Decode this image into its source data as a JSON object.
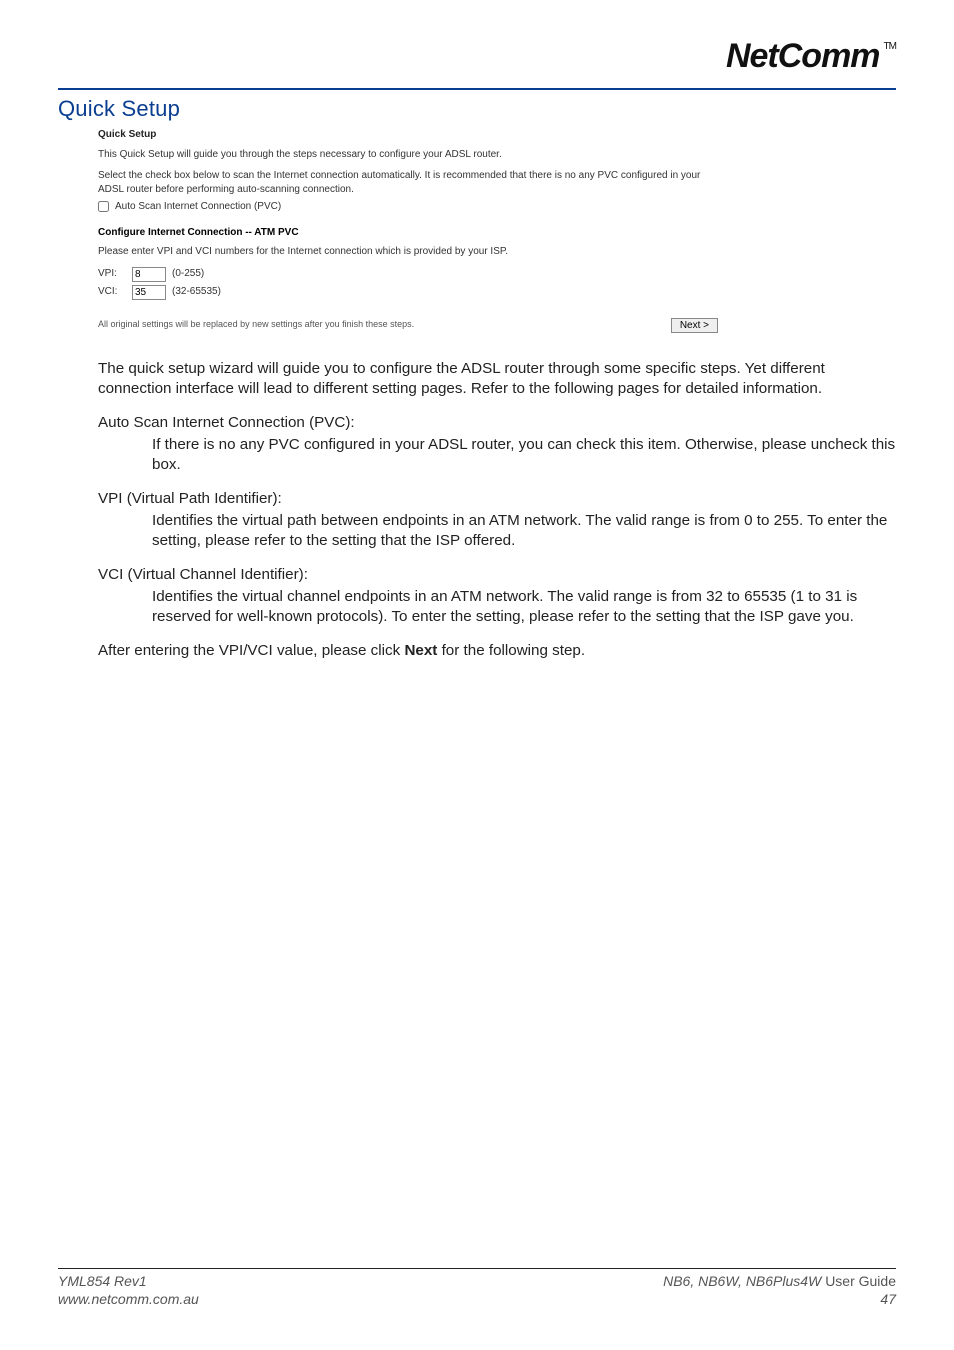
{
  "logo": {
    "text": "NetComm",
    "tm": "TM"
  },
  "section_title": "Quick Setup",
  "router_ui": {
    "qs_title": "Quick Setup",
    "qs_desc": "This Quick Setup will guide you through the steps necessary to configure your ADSL router.",
    "qs_note": "Select the check box below to scan the Internet connection automatically. It is recommended that there is no any PVC configured in your ADSL router before performing auto-scanning connection.",
    "autoscan_label": "Auto Scan Internet Connection (PVC)",
    "cfg_title": "Configure Internet Connection -- ATM PVC",
    "cfg_desc": "Please enter VPI and VCI numbers for the Internet connection which is provided by your ISP.",
    "vpi_label": "VPI:",
    "vpi_value": "8",
    "vpi_range": "(0-255)",
    "vci_label": "VCI:",
    "vci_value": "35",
    "vci_range": "(32-65535)",
    "footer_text": "All original settings will be replaced by new settings after you finish these steps.",
    "next_label": "Next >"
  },
  "doc": {
    "intro": "The quick setup wizard will guide you to configure the ADSL router through some specific steps. Yet different connection interface will lead to different setting pages. Refer to the following pages for detailed information.",
    "autoscan_head": "Auto Scan Internet Connection (PVC):",
    "autoscan_desc": "If there is no any PVC configured in your ADSL router, you can check this item. Otherwise, please uncheck this box.",
    "vpi_head": "VPI (Virtual Path Identifier):",
    "vpi_desc": "Identifies the virtual path between endpoints in an ATM network. The valid range is from 0 to 255. To enter the setting, please refer to the setting that the ISP offered.",
    "vci_head": "VCI (Virtual Channel Identifier):",
    "vci_desc": "Identifies the virtual channel endpoints in an ATM network. The valid range is from 32 to 65535 (1 to 31 is reserved for well-known protocols). To enter the setting, please refer to the setting that the ISP gave you.",
    "after_pre": "After entering the VPI/VCI value, please click ",
    "after_bold": "Next",
    "after_post": " for the following step."
  },
  "footer": {
    "rev": "YML854 Rev1",
    "url": "www.netcomm.com.au",
    "models": "NB6, NB6W, NB6Plus4W ",
    "ug": "User Guide",
    "page": "47"
  }
}
